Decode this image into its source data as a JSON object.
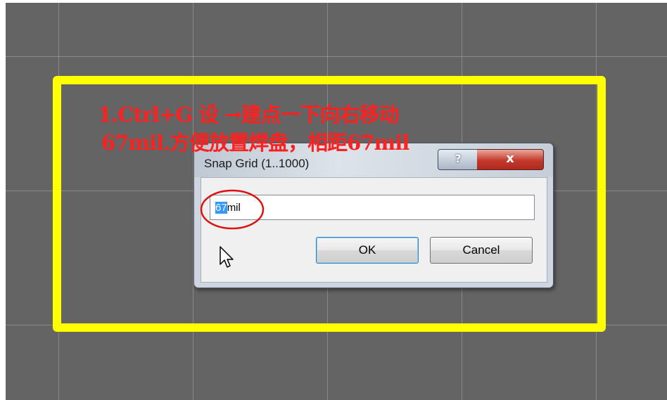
{
  "annotation": {
    "line1": "1.Ctrl+G 设 →建点一下向右移动",
    "line2": "67mil.方便放置焊盘，相距67mil"
  },
  "dialog": {
    "title": "Snap Grid (1..1000)",
    "help_label": "?",
    "close_label": "x",
    "input": {
      "selected_text": "67",
      "rest_text": "mil"
    },
    "ok_label": "OK",
    "cancel_label": "Cancel"
  },
  "colors": {
    "canvas": "#646464",
    "grid": "#aaaaaa",
    "highlight_frame": "#ffff00",
    "annotation_text": "#ff2020",
    "selection": "#3399ff"
  },
  "icons": [
    "cursor-arrow-icon"
  ]
}
